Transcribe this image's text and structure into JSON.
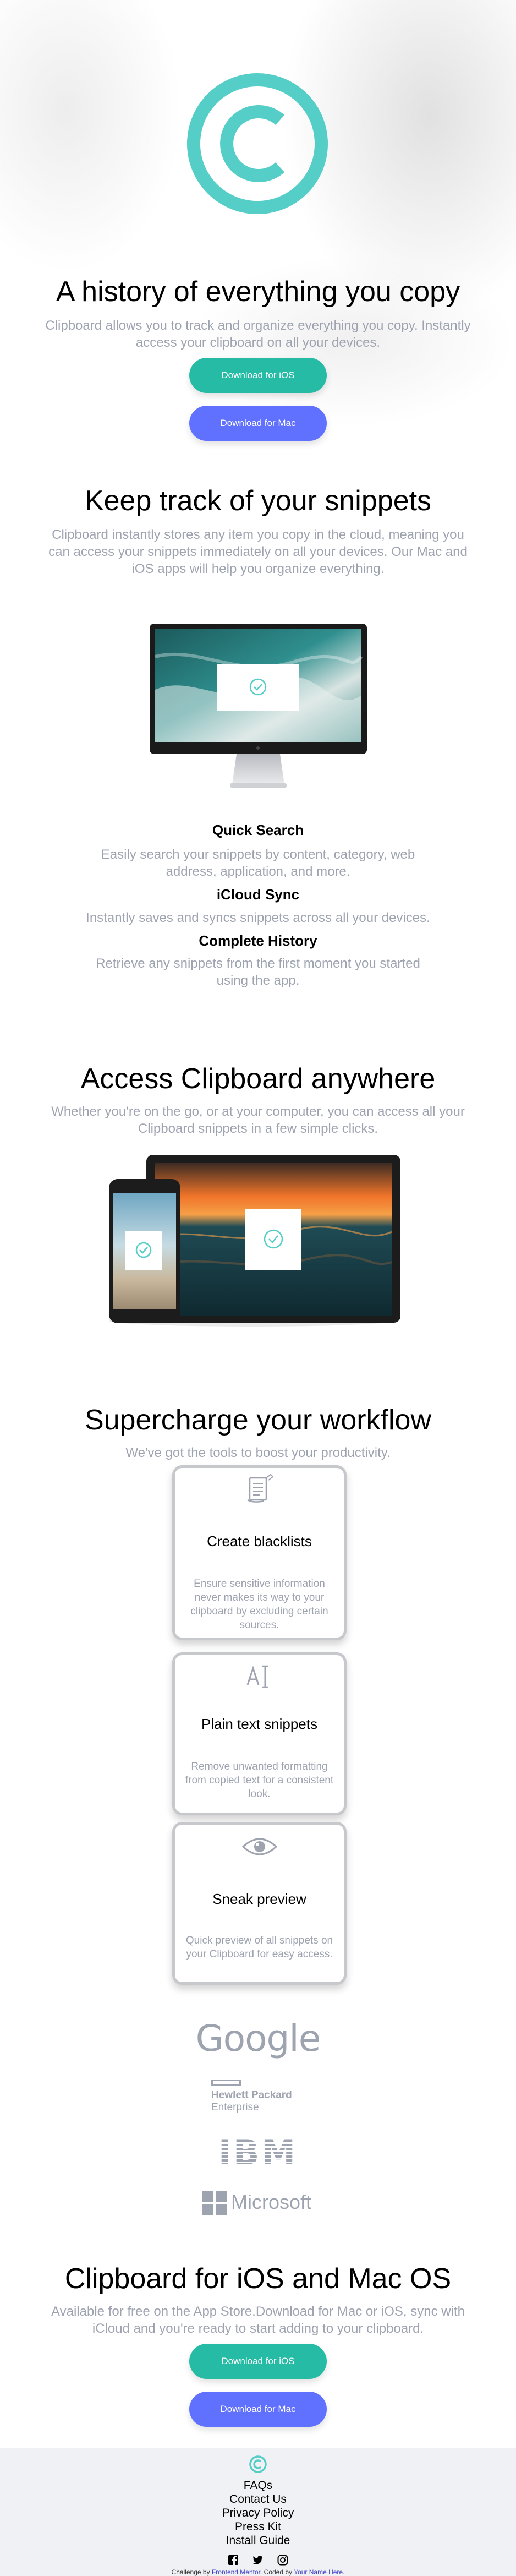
{
  "hero": {
    "title": "A history of everything you copy",
    "subtitle": "Clipboard allows you to track and organize everything you copy. Instantly access your clipboard on all your devices.",
    "ios_button": "Download for iOS",
    "mac_button": "Download for Mac"
  },
  "snippets": {
    "title": "Keep track of your snippets",
    "subtitle": "Clipboard instantly stores any item you copy in the cloud, meaning you can access your snippets immediately on all your devices. Our Mac and iOS apps will help you organize everything.",
    "features": [
      {
        "title": "Quick Search",
        "text": "Easily search your snippets by content, category, web address, application, and more."
      },
      {
        "title": "iCloud Sync",
        "text": "Instantly saves and syncs snippets across all your devices."
      },
      {
        "title": "Complete History",
        "text": "Retrieve any snippets from the first moment you started using the app."
      }
    ]
  },
  "access": {
    "title": "Access Clipboard anywhere",
    "subtitle": "Whether you're on the go, or at your computer, you can access all your Clipboard snippets in a few simple clicks."
  },
  "workflow": {
    "title": "Supercharge your workflow",
    "subtitle": "We've got the tools to boost your productivity.",
    "cards": [
      {
        "icon": "blacklist-icon",
        "title": "Create blacklists",
        "text": "Ensure sensitive information never makes its way to your clipboard by excluding certain sources."
      },
      {
        "icon": "text-icon",
        "title": "Plain text snippets",
        "text": "Remove unwanted formatting from copied text for a consistent look."
      },
      {
        "icon": "eye-icon",
        "title": "Sneak preview",
        "text": "Quick preview of all snippets on your Clipboard for easy access."
      }
    ]
  },
  "partners": {
    "google": "Google",
    "hp_line1": "Hewlett Packard",
    "hp_line2": "Enterprise",
    "ibm": "IBM",
    "microsoft": "Microsoft"
  },
  "cta": {
    "title": "Clipboard for iOS and Mac OS",
    "subtitle": "Available for free on the App Store.Download for Mac or iOS, sync with iCloud and you're ready to start adding to your clipboard.",
    "ios_button": "Download for iOS",
    "mac_button": "Download for Mac"
  },
  "footer": {
    "links": [
      "FAQs",
      "Contact Us",
      "Privacy Policy",
      "Press Kit",
      "Install Guide"
    ],
    "social": [
      "facebook-icon",
      "twitter-icon",
      "instagram-icon"
    ],
    "credit_prefix": "Challenge by",
    "credit_link1": "Frontend Mentor",
    "credit_middle": ". Coded by",
    "credit_link2": "Your Name Here",
    "credit_suffix": "."
  },
  "colors": {
    "accent_teal": "#26bba5",
    "accent_blue": "#6070ff",
    "text_gray": "#9ea3b0",
    "logo_teal": "#55cec7"
  }
}
